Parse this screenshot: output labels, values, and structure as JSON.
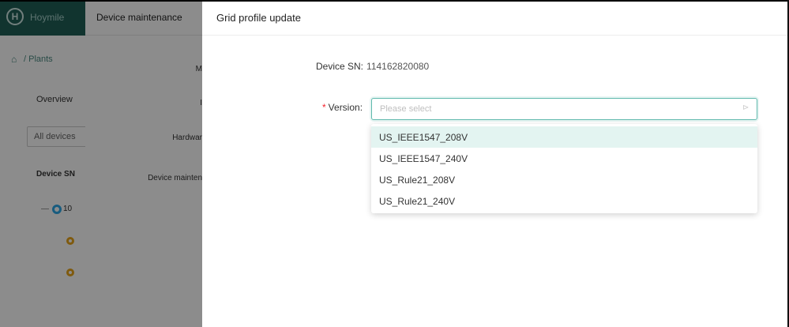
{
  "app": {
    "logo_letter": "H",
    "logo_text": "Hoymile",
    "breadcrumb": "/ Plants",
    "overview_tab": "Overview",
    "device_filter": "All devices",
    "column_sn": "Device SN",
    "tree_row_label": "10"
  },
  "middle_panel": {
    "title": "Device maintenance",
    "labels": [
      "M",
      "I",
      "Hardwar",
      "Device mainten"
    ]
  },
  "drawer": {
    "title": "Grid profile update",
    "device_sn_label": "Device SN:",
    "device_sn_value": "114162820080",
    "version_required_mark": "*",
    "version_label": "Version:",
    "version_placeholder": "Please select",
    "version_options": [
      "US_IEEE1547_208V",
      "US_IEEE1547_240V",
      "US_Rule21_208V",
      "US_Rule21_240V"
    ],
    "active_option_index": 0
  },
  "colors": {
    "brand": "#1f5f57",
    "accent": "#5fb9ad",
    "option_hover": "#e3f4f1",
    "required": "#f5222d"
  }
}
